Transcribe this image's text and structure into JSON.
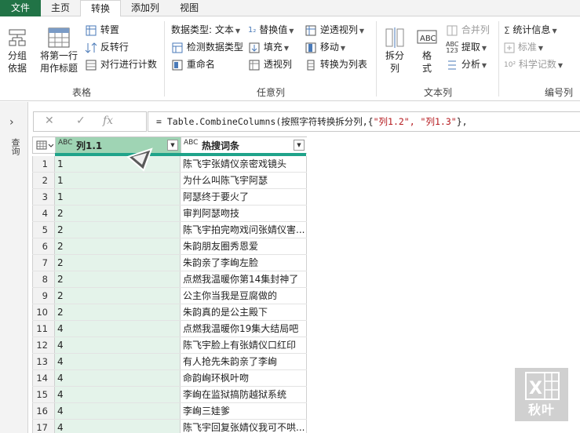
{
  "menubar": {
    "tabs": [
      "文件",
      "主页",
      "转换",
      "添加列",
      "视图"
    ]
  },
  "ribbon": {
    "table_group": {
      "label": "表格",
      "group_by": "分组\n依据",
      "use_first_row": "将第一行\n用作标题",
      "transpose": "转置",
      "reverse_rows": "反转行",
      "count_rows": "对行进行计数"
    },
    "any_column_group": {
      "label": "任意列",
      "data_type": "数据类型: 文本",
      "detect_type": "检测数据类型",
      "rename": "重命名",
      "replace_values": "替换值",
      "fill": "填充",
      "pivot_column": "透视列",
      "unpivot_columns": "逆透视列",
      "move": "移动",
      "convert_to_list": "转换为列表"
    },
    "text_column_group": {
      "label": "文本列",
      "split_column": "拆分\n列",
      "format": "格\n式",
      "merge_columns": "合并列",
      "extract": "提取",
      "parse": "分析"
    },
    "number_column_group": {
      "label": "编号列",
      "statistics": "统计信息",
      "standard": "标准",
      "scientific": "科学记数"
    }
  },
  "leftpane": {
    "chevron": "›",
    "label": "查询"
  },
  "formula_bar": {
    "cancel_glyph": "✕",
    "confirm_glyph": "✓",
    "fx": "fx",
    "formula_prefix": "= Table.CombineColumns(按照字符转换拆分列,{",
    "formula_strings": "\"列1.2\", \"列1.3\"",
    "formula_suffix": "},"
  },
  "grid": {
    "columns": [
      {
        "type": "ABC",
        "name": "列1.1"
      },
      {
        "type": "ABC",
        "name": "热搜词条"
      }
    ],
    "rows": [
      {
        "n": "1",
        "a": "1",
        "b": "陈飞宇张婧仪亲密戏镜头"
      },
      {
        "n": "2",
        "a": "1",
        "b": "为什么叫陈飞宇阿瑟"
      },
      {
        "n": "3",
        "a": "1",
        "b": "阿瑟终于要火了"
      },
      {
        "n": "4",
        "a": "2",
        "b": "审判阿瑟吻技"
      },
      {
        "n": "5",
        "a": "2",
        "b": "陈飞宇拍完吻戏问张婧仪害..."
      },
      {
        "n": "6",
        "a": "2",
        "b": "朱韵朋友圈秀恩爱"
      },
      {
        "n": "7",
        "a": "2",
        "b": "朱韵亲了李峋左脸"
      },
      {
        "n": "8",
        "a": "2",
        "b": "点燃我温暖你第14集封神了"
      },
      {
        "n": "9",
        "a": "2",
        "b": "公主你当我是豆腐做的"
      },
      {
        "n": "10",
        "a": "2",
        "b": "朱韵真的是公主殿下"
      },
      {
        "n": "11",
        "a": "4",
        "b": "点燃我温暖你19集大结局吧"
      },
      {
        "n": "12",
        "a": "4",
        "b": "陈飞宇脸上有张婧仪口红印"
      },
      {
        "n": "13",
        "a": "4",
        "b": "有人抢先朱韵亲了李峋"
      },
      {
        "n": "14",
        "a": "4",
        "b": "命韵峋环枫叶吻"
      },
      {
        "n": "15",
        "a": "4",
        "b": "李峋在监狱搞防越狱系统"
      },
      {
        "n": "16",
        "a": "4",
        "b": "李峋三娃爹"
      },
      {
        "n": "17",
        "a": "4",
        "b": "陈飞宇回复张婧仪我可不哄..."
      }
    ]
  },
  "watermark": {
    "text": "秋叶"
  },
  "colors": {
    "file_tab": "#217346",
    "selected_column": "#9fd4b4",
    "selected_cells": "#e4f3ea",
    "quality_bar": "#1fa38a"
  }
}
